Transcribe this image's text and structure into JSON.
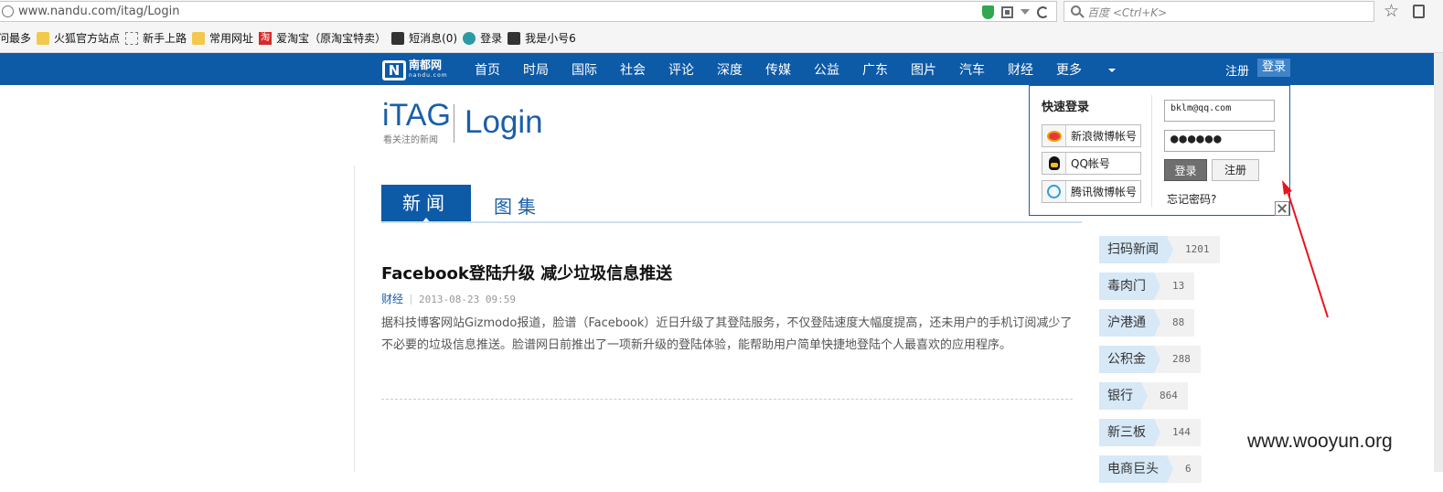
{
  "browser": {
    "url": "www.nandu.com/itag/Login",
    "search_placeholder": "百度 <Ctrl+K>",
    "bookmarks": [
      {
        "label": "问最多",
        "icon": "none-icon"
      },
      {
        "label": "火狐官方站点",
        "icon": "folder-icon"
      },
      {
        "label": "新手上路",
        "icon": "page-icon"
      },
      {
        "label": "常用网址",
        "icon": "folder-icon"
      },
      {
        "label": "爱淘宝（原淘宝特卖）",
        "icon": "taobao-icon"
      },
      {
        "label": "短消息(0)",
        "icon": "site-icon"
      },
      {
        "label": "登录",
        "icon": "round-site-icon"
      },
      {
        "label": "我是小号6",
        "icon": "site-icon"
      }
    ]
  },
  "nav": {
    "logo_main": "南都网",
    "logo_sub": "nandu.com",
    "logo_letter": "N",
    "items": [
      "首页",
      "时局",
      "国际",
      "社会",
      "评论",
      "深度",
      "传媒",
      "公益",
      "广东",
      "图片",
      "汽车",
      "财经"
    ],
    "more": "更多",
    "register": "注册",
    "login": "登录"
  },
  "header": {
    "brand": "iTAG",
    "brand_sub": "看关注的新闻",
    "page_title": "Login"
  },
  "tabs": {
    "news": "新闻",
    "photos": "图集"
  },
  "article": {
    "title": "Facebook登陆升级 减少垃圾信息推送",
    "category": "财经",
    "date": "2013-08-23 09:59",
    "body": "据科技博客网站Gizmodo报道，脸谱（Facebook）近日升级了其登陆服务，不仅登陆速度大幅度提高，还未用户的手机订阅减少了不必要的垃圾信息推送。脸谱网日前推出了一项新升级的登陆体验，能帮助用户简单快捷地登陆个人最喜欢的应用程序。"
  },
  "tags": [
    {
      "name": "扫码新闻",
      "count": "1201"
    },
    {
      "name": "毒肉门",
      "count": "13"
    },
    {
      "name": "沪港通",
      "count": "88"
    },
    {
      "name": "公积金",
      "count": "288"
    },
    {
      "name": "银行",
      "count": "864"
    },
    {
      "name": "新三板",
      "count": "144"
    },
    {
      "name": "电商巨头",
      "count": "6"
    }
  ],
  "login_popup": {
    "quick_login": "快速登录",
    "sso": [
      "新浪微博帐号",
      "QQ帐号",
      "腾讯微博帐号"
    ],
    "email_value": "bklm@qq.com",
    "password_mask": "●●●●●●",
    "login_button": "登录",
    "register_button": "注册",
    "forgot": "忘记密码?"
  },
  "watermark": "www.wooyun.org",
  "colors": {
    "nav_blue": "#0d5aa7",
    "annotation_red": "#e8141b"
  }
}
